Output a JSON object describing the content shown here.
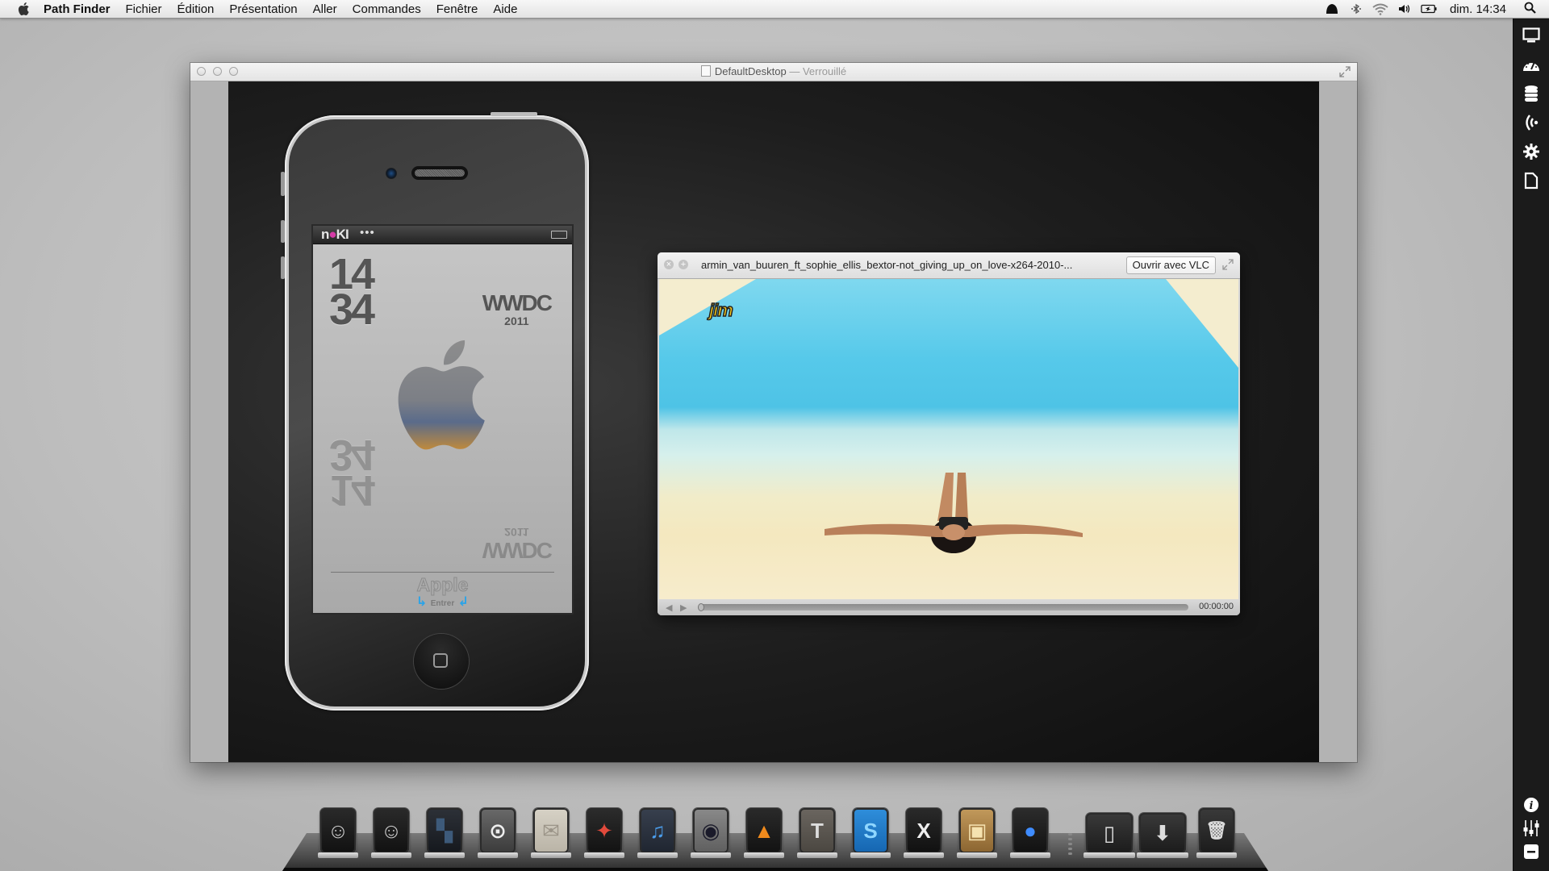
{
  "menubar": {
    "apple_icon": "apple-icon",
    "app_name": "Path Finder",
    "menus": [
      "Fichier",
      "Édition",
      "Présentation",
      "Aller",
      "Commandes",
      "Fenêtre",
      "Aide"
    ],
    "status_icons": [
      "growl-icon",
      "bluetooth-icon",
      "wifi-icon",
      "volume-icon",
      "battery-icon"
    ],
    "clock": "dim. 14:34",
    "spotlight_icon": "search-icon"
  },
  "sidebar": {
    "top_items": [
      "display-icon",
      "dashboard-gauge-icon",
      "database-icon",
      "wireless-icon",
      "gear-icon",
      "document-icon"
    ],
    "bottom_items": [
      "info-icon",
      "sliders-icon",
      "minus-icon"
    ]
  },
  "window": {
    "title": "DefaultDesktop",
    "title_suffix": " — Verrouillé"
  },
  "phone": {
    "carrier_logo_pre": "n",
    "carrier_logo_drop": "●",
    "carrier_logo_post": "KI",
    "carrier_dots": "•••",
    "hour": "14",
    "minute": "34",
    "event": "WWDC",
    "event_year": "2011",
    "unlock_word": "Apple",
    "unlock_hint": "Entrer",
    "unlock_arrow_left": "↳",
    "unlock_arrow_right": "↲"
  },
  "quicklook": {
    "file_name": "armin_van_buuren_ft_sophie_ellis_bextor-not_giving_up_on_love-x264-2010-...",
    "open_with_label": "Ouvrir avec VLC",
    "video_watermark": "jim",
    "timecode": "00:00:00",
    "progress": 0,
    "rewind_glyph": "◀",
    "play_glyph": "▶"
  },
  "dock": {
    "items": [
      {
        "name": "finder",
        "glyph": "☺"
      },
      {
        "name": "finder-2",
        "glyph": "☺"
      },
      {
        "name": "spaces",
        "glyph": "▚"
      },
      {
        "name": "1password",
        "glyph": "⊙"
      },
      {
        "name": "mail",
        "glyph": "✉"
      },
      {
        "name": "safari",
        "glyph": "✦"
      },
      {
        "name": "itunes",
        "glyph": "♫"
      },
      {
        "name": "photo-booth",
        "glyph": "◉"
      },
      {
        "name": "vlc",
        "glyph": "▲"
      },
      {
        "name": "textedit",
        "glyph": "T"
      },
      {
        "name": "skype",
        "glyph": "S"
      },
      {
        "name": "xcode",
        "glyph": "X"
      },
      {
        "name": "iphoto",
        "glyph": "▣"
      },
      {
        "name": "network-utility",
        "glyph": "●"
      }
    ],
    "stacks": [
      {
        "name": "documents",
        "glyph": "▯"
      },
      {
        "name": "downloads",
        "glyph": "⬇"
      }
    ],
    "trash": {
      "name": "trash",
      "glyph": "🗑"
    }
  }
}
